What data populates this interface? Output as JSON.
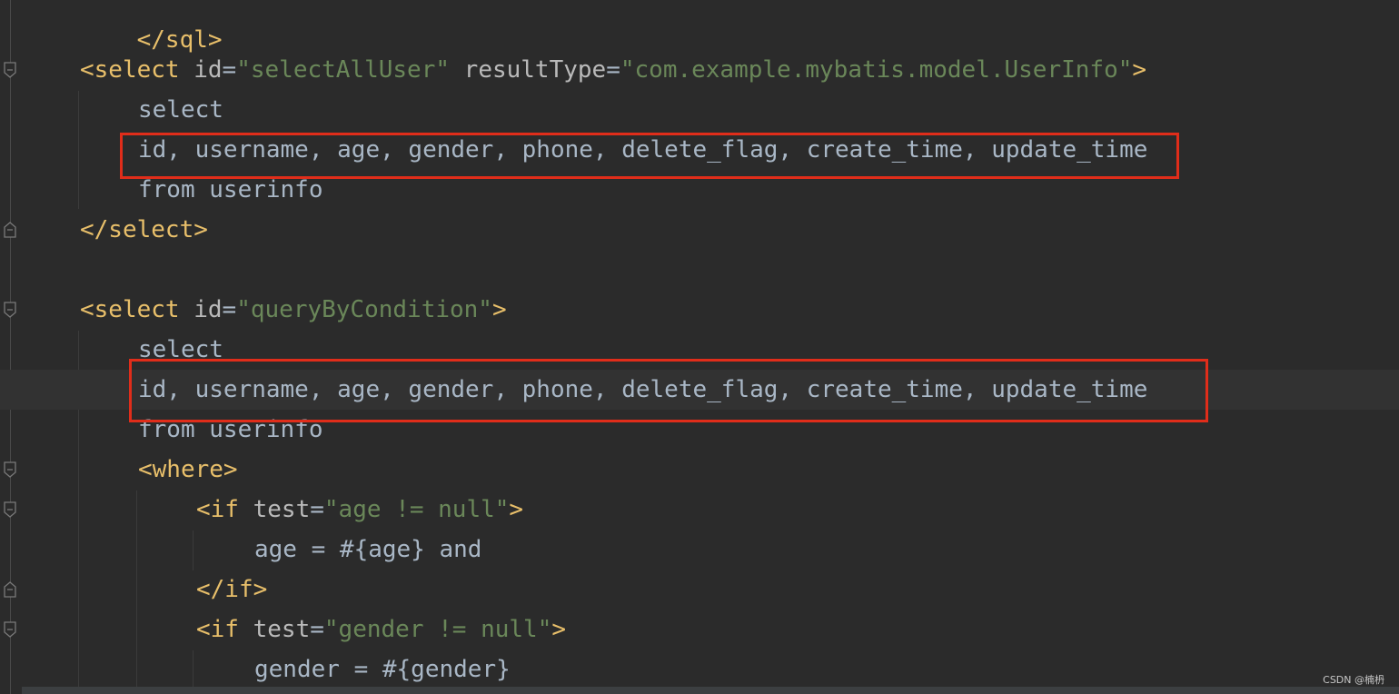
{
  "editor": {
    "top_fragment": "</sql>",
    "lines": [
      {
        "parts": [
          {
            "c": "tag",
            "t": "<select "
          },
          {
            "c": "attr",
            "t": "id"
          },
          {
            "c": "eq",
            "t": "="
          },
          {
            "c": "str",
            "t": "\"selectAllUser\""
          },
          {
            "c": "attr",
            "t": " resultType"
          },
          {
            "c": "eq",
            "t": "="
          },
          {
            "c": "str",
            "t": "\"com.example.mybatis.model.UserInfo\""
          },
          {
            "c": "tag",
            "t": ">"
          }
        ]
      },
      {
        "parts": [
          {
            "c": "txt",
            "t": "select"
          }
        ]
      },
      {
        "parts": [
          {
            "c": "txt",
            "t": "id, username, age, gender, phone, delete_flag, create_time, update_time"
          }
        ]
      },
      {
        "parts": [
          {
            "c": "txt",
            "t": "from userinfo"
          }
        ]
      },
      {
        "parts": [
          {
            "c": "tag",
            "t": "</select>"
          }
        ]
      },
      {
        "parts": []
      },
      {
        "parts": [
          {
            "c": "tag",
            "t": "<select "
          },
          {
            "c": "attr",
            "t": "id"
          },
          {
            "c": "eq",
            "t": "="
          },
          {
            "c": "str",
            "t": "\"queryByCondition\""
          },
          {
            "c": "tag",
            "t": ">"
          }
        ]
      },
      {
        "parts": [
          {
            "c": "txt",
            "t": "select"
          }
        ]
      },
      {
        "parts": [
          {
            "c": "txt",
            "t": "id, username, age, gender, phone, delete_flag, create_time, update_time"
          }
        ]
      },
      {
        "parts": [
          {
            "c": "txt",
            "t": "from userinfo"
          }
        ]
      },
      {
        "parts": [
          {
            "c": "tag",
            "t": "<where>"
          }
        ]
      },
      {
        "parts": [
          {
            "c": "tag",
            "t": "<if "
          },
          {
            "c": "attr",
            "t": "test"
          },
          {
            "c": "eq",
            "t": "="
          },
          {
            "c": "str",
            "t": "\"age != null\""
          },
          {
            "c": "tag",
            "t": ">"
          }
        ]
      },
      {
        "parts": [
          {
            "c": "txt",
            "t": "age = #{age} and"
          }
        ]
      },
      {
        "parts": [
          {
            "c": "tag",
            "t": "</if>"
          }
        ]
      },
      {
        "parts": [
          {
            "c": "tag",
            "t": "<if "
          },
          {
            "c": "attr",
            "t": "test"
          },
          {
            "c": "eq",
            "t": "="
          },
          {
            "c": "str",
            "t": "\"gender != null\""
          },
          {
            "c": "tag",
            "t": ">"
          }
        ]
      },
      {
        "parts": [
          {
            "c": "txt",
            "t": "gender = #{gender}"
          }
        ]
      }
    ]
  },
  "colors": {
    "background": "#2b2b2b",
    "tag": "#e8bf6a",
    "attribute": "#bababa",
    "string": "#6a8759",
    "text": "#a9b7c6",
    "highlight_box": "#e02d1a"
  },
  "icons": [
    "fold-marker-icon"
  ],
  "watermark": "CSDN @楠枬"
}
